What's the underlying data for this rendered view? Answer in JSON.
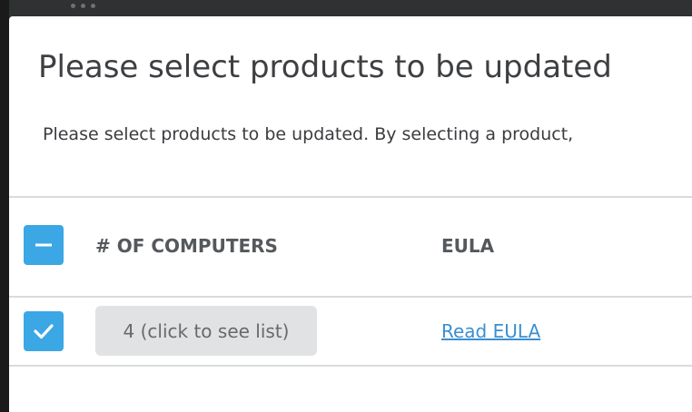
{
  "dialog": {
    "title": "Please select products to be updated",
    "description": "Please select products to be updated. By selecting a product,"
  },
  "table": {
    "select_all_state": "indeterminate",
    "columns": [
      "# OF COMPUTERS",
      "EULA"
    ],
    "rows": [
      {
        "checked": true,
        "computers_label": "4 (click to see list)",
        "eula_link": "Read EULA"
      }
    ]
  },
  "colors": {
    "accent": "#3ba7e5",
    "link": "#3b8fd0",
    "pill_bg": "#e1e2e3"
  },
  "icons": {
    "select_all": "minus-icon",
    "row_checkbox": "checkmark-icon"
  }
}
